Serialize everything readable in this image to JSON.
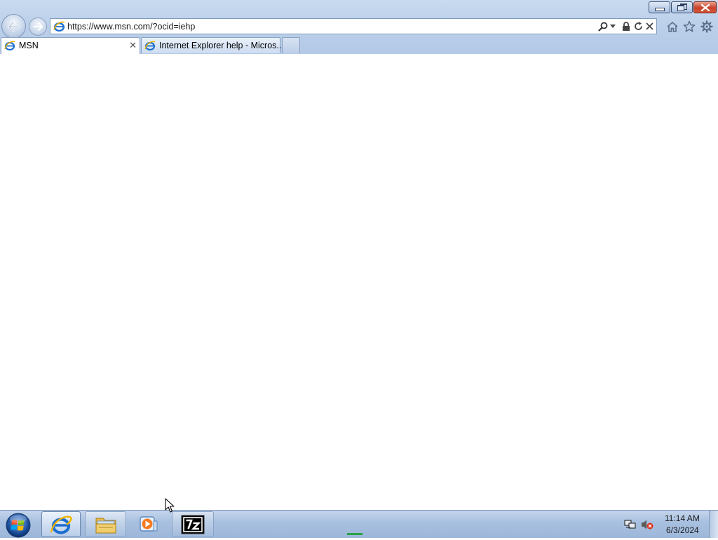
{
  "browser": {
    "address": {
      "url": "https://www.msn.com/?ocid=iehp"
    },
    "tabs": [
      {
        "label": "MSN",
        "active": true
      },
      {
        "label": "Internet Explorer help - Micros...",
        "active": false
      }
    ],
    "address_tools": [
      "search-icon",
      "dropdown-arrow-icon",
      "lock-icon",
      "refresh-icon",
      "stop-icon"
    ],
    "command_icons": [
      "home-icon",
      "favorites-star-icon",
      "gear-icon"
    ],
    "window_controls": [
      "minimize",
      "restore",
      "close"
    ]
  },
  "taskbar": {
    "items": [
      "start-orb",
      "internet-explorer",
      "windows-explorer",
      "media-player",
      "7-zip"
    ],
    "clock": {
      "time": "11:14 AM",
      "date": "6/3/2024"
    },
    "tray_icons": [
      "network-icon",
      "volume-muted-icon"
    ]
  },
  "colors": {
    "chrome": "#bcd0ea",
    "close_button": "#c8412a",
    "taskbar": "#a9c1e0"
  }
}
